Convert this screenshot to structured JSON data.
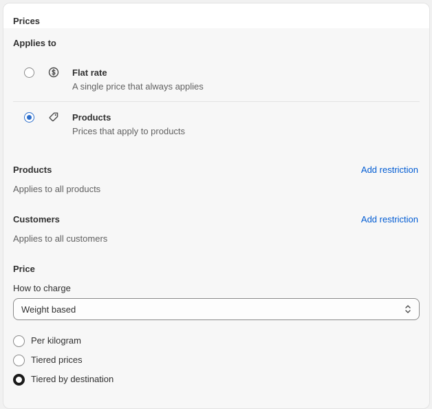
{
  "card": {
    "title": "Prices"
  },
  "applies_to": {
    "heading": "Applies to",
    "options": [
      {
        "label": "Flat rate",
        "description": "A single price that always applies",
        "icon": "dollar-circle-icon",
        "selected": false
      },
      {
        "label": "Products",
        "description": "Prices that apply to products",
        "icon": "tag-icon",
        "selected": true
      }
    ]
  },
  "products": {
    "heading": "Products",
    "action": "Add restriction",
    "summary": "Applies to all products"
  },
  "customers": {
    "heading": "Customers",
    "action": "Add restriction",
    "summary": "Applies to all customers"
  },
  "price": {
    "heading": "Price",
    "how_to_charge_label": "How to charge",
    "how_to_charge_value": "Weight based",
    "methods": [
      {
        "label": "Per kilogram",
        "selected": false
      },
      {
        "label": "Tiered prices",
        "selected": false
      },
      {
        "label": "Tiered by destination",
        "selected": true
      }
    ]
  },
  "colors": {
    "accent": "#2c6ecb",
    "link": "#005bd3",
    "text": "#303030",
    "muted": "#616161"
  }
}
